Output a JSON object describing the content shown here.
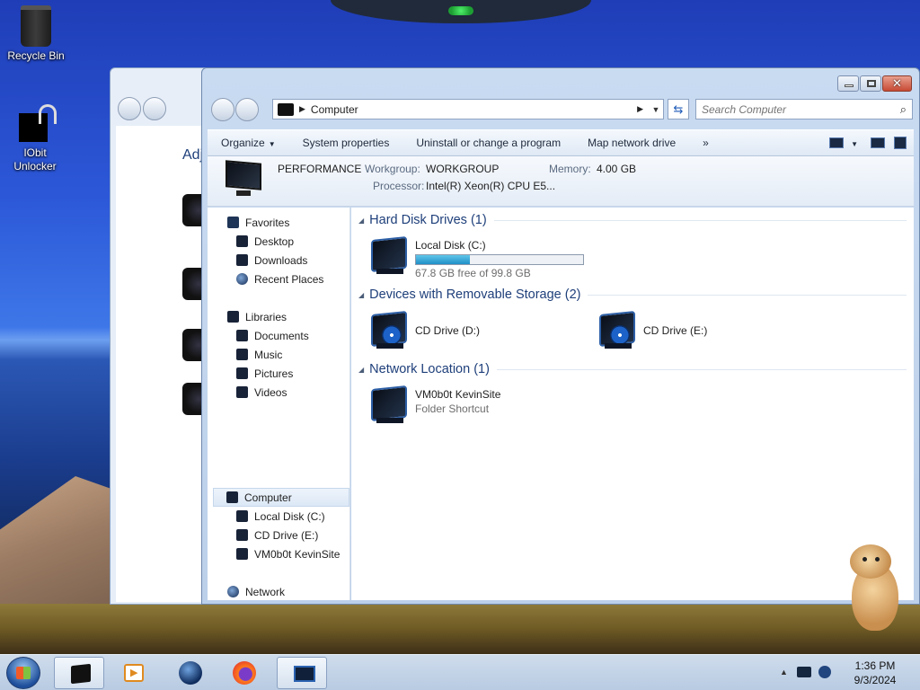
{
  "desktop": {
    "icons": [
      {
        "label": "Recycle Bin",
        "icon": "recycle-bin-icon"
      },
      {
        "label": "IObit Unlocker",
        "icon": "iobit-unlocker-icon"
      }
    ]
  },
  "back_window": {
    "partial_text": "Adj"
  },
  "window": {
    "address": {
      "location": "Computer",
      "icon": "computer-icon"
    },
    "search": {
      "placeholder": "Search Computer"
    },
    "toolbar": {
      "organize": "Organize",
      "system_properties": "System properties",
      "uninstall": "Uninstall or change a program",
      "map_drive": "Map network drive",
      "overflow": "»"
    },
    "details": {
      "computer_name": "PERFORMANCE",
      "workgroup_label": "Workgroup:",
      "workgroup_value": "WORKGROUP",
      "memory_label": "Memory:",
      "memory_value": "4.00 GB",
      "processor_label": "Processor:",
      "processor_value": "Intel(R) Xeon(R) CPU E5..."
    },
    "nav_pane": {
      "favorites": "Favorites",
      "desktop": "Desktop",
      "downloads": "Downloads",
      "recent_places": "Recent Places",
      "libraries": "Libraries",
      "documents": "Documents",
      "music": "Music",
      "pictures": "Pictures",
      "videos": "Videos",
      "computer": "Computer",
      "local_disk": "Local Disk (C:)",
      "cd_drive_e": "CD Drive (E:)",
      "kevinsite": "VM0b0t KevinSite",
      "network": "Network"
    },
    "groups": {
      "hdd": "Hard Disk Drives (1)",
      "removable": "Devices with Removable Storage (2)",
      "network": "Network Location (1)"
    },
    "items": {
      "local_disk": {
        "name": "Local Disk (C:)",
        "free": "67.8 GB free of 99.8 GB",
        "used_fraction": 0.32
      },
      "cd_d": {
        "name": "CD Drive (D:)"
      },
      "cd_e": {
        "name": "CD Drive (E:)"
      },
      "kevinsite": {
        "name": "VM0b0t KevinSite",
        "type": "Folder Shortcut"
      }
    }
  },
  "taskbar": {
    "pinned": [
      "windows-explorer-icon",
      "media-player-icon",
      "browser-globe-icon",
      "firefox-icon",
      "computer-monitor-icon"
    ],
    "clock_time": "1:36 PM",
    "clock_date": "9/3/2024"
  }
}
